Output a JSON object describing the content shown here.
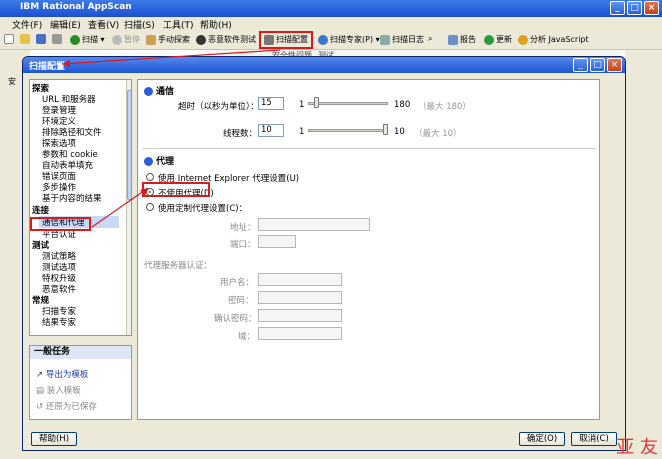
{
  "window": {
    "title": "IBM Rational AppScan"
  },
  "menubar": {
    "items": [
      "文件(F)",
      "编辑(E)",
      "查看(V)",
      "扫描(S)",
      "工具(T)",
      "帮助(H)"
    ]
  },
  "toolbar": {
    "scan": "扫描",
    "pause": "暂停",
    "manual_explore": "手动探索",
    "malware_test": "恶意软件测试",
    "scan_config": "扫描配置",
    "scan_expert": "扫描专家(P)",
    "scan_log": "扫描日志",
    "report": "报告",
    "update": "更新",
    "analyze_js": "分析 JavaScript"
  },
  "background": {
    "cols": [
      "安全性问题",
      "测试"
    ],
    "left_label": "安"
  },
  "dialog": {
    "title": "扫描配置",
    "nav": {
      "cat_explore": "探索",
      "explore_items": [
        "URL 和服务器",
        "登录管理",
        "环境定义",
        "排除路径和文件",
        "探索选项",
        "参数和 cookie",
        "自动表单填充",
        "错误页面",
        "多步操作",
        "基于内容的结果"
      ],
      "cat_connection": "连接",
      "connection_items": [
        "通信和代理",
        "平台认证"
      ],
      "cat_test": "测试",
      "test_items": [
        "测试策略",
        "测试选项",
        "特权升级",
        "恶意软件"
      ],
      "cat_general": "常规",
      "general_items": [
        "扫描专家",
        "结果专家"
      ]
    },
    "tasks": {
      "header": "一般任务",
      "items": [
        "导出为模板",
        "装入模板",
        "还原为已保存"
      ]
    },
    "comm": {
      "section_title": "通信",
      "timeout_label": "超时（以秒为单位）：",
      "timeout_value": "15",
      "timeout_min": "1",
      "timeout_max": "180",
      "timeout_hint": "（最大 180）",
      "timeout_fraction": 0.08,
      "threads_label": "线程数：",
      "threads_value": "10",
      "threads_min": "1",
      "threads_max": "10",
      "threads_hint": "（最大 10）",
      "threads_fraction": 1.0
    },
    "proxy": {
      "section_title": "代理",
      "opt_ie": "使用 Internet Explorer 代理设置(U)",
      "opt_none": "不使用代理(D)",
      "opt_custom": "使用定制代理设置(C)：",
      "address_label": "地址：",
      "port_label": "端口：",
      "auth_label": "代理服务器认证：",
      "username_label": "用户名：",
      "password_label": "密码：",
      "confirm_label": "确认密码：",
      "domain_label": "域："
    },
    "buttons": {
      "help": "帮助(H)",
      "ok": "确定(O)",
      "cancel": "取消(C)"
    }
  },
  "watermark": "亚 友",
  "colors": {
    "highlight": "#d81b1b",
    "titlebar": "#1b4fd1"
  }
}
